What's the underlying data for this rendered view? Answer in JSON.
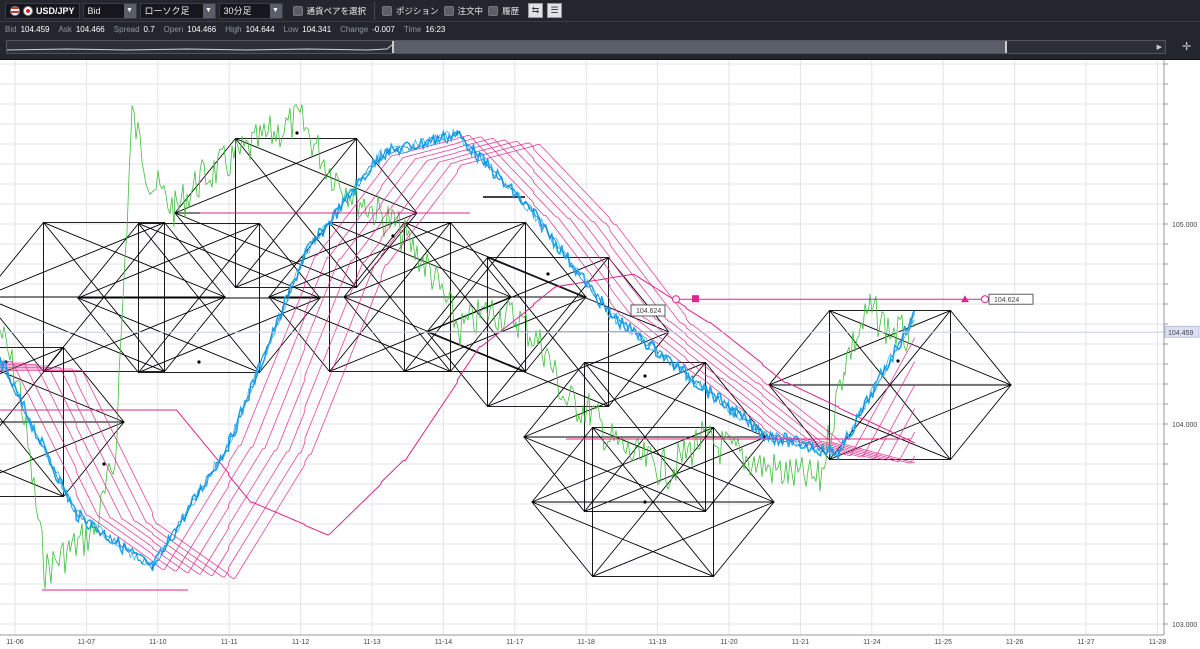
{
  "toolbar": {
    "symbol": "USD/JPY",
    "price_type": "Bid",
    "chart_type": "ローソク足",
    "timeframe": "30分足",
    "pair_select": "通貨ペアを選択",
    "position": "ポジション",
    "orders": "注文中",
    "history": "履歴"
  },
  "quote": {
    "bid_label": "Bid",
    "bid": "104.459",
    "ask_label": "Ask",
    "ask": "104.466",
    "spread_label": "Spread",
    "spread": "0.7",
    "open_label": "Open",
    "open": "104.466",
    "high_label": "High",
    "high": "104.644",
    "low_label": "Low",
    "low": "104.341",
    "change_label": "Change",
    "change": "-0.007",
    "time_label": "Time",
    "time": "16:23"
  },
  "chart_data": {
    "type": "line",
    "symbol": "USD/JPY",
    "timeframe": "30分足",
    "x": [
      "11-06",
      "11-07",
      "11-10",
      "11-11",
      "11-12",
      "11-13",
      "11-14",
      "11-17",
      "11-18",
      "11-19",
      "11-20",
      "11-21",
      "11-24",
      "11-25",
      "11-26",
      "11-27",
      "11-28"
    ],
    "y_ticks": [
      "105.000",
      "104.000",
      "103.000"
    ],
    "ylim": [
      103.0,
      105.85
    ],
    "current_price": "104.459",
    "horizontal_line_label": "104.624",
    "horizontal_line_price": 104.624,
    "trend_label": "104.624",
    "series": [
      {
        "values": [
          104.32,
          103.55,
          103.28,
          103.9,
          104.85,
          105.35,
          105.45,
          105.05,
          104.55,
          104.25,
          103.95,
          103.85,
          104.55
        ]
      }
    ],
    "colors": {
      "price": "#1fa3ea",
      "ema_band": "#e0248a",
      "oscillator": "#3fbf3f",
      "pattern": "#000000",
      "grid": "#e3e3ee"
    },
    "grid": true
  }
}
